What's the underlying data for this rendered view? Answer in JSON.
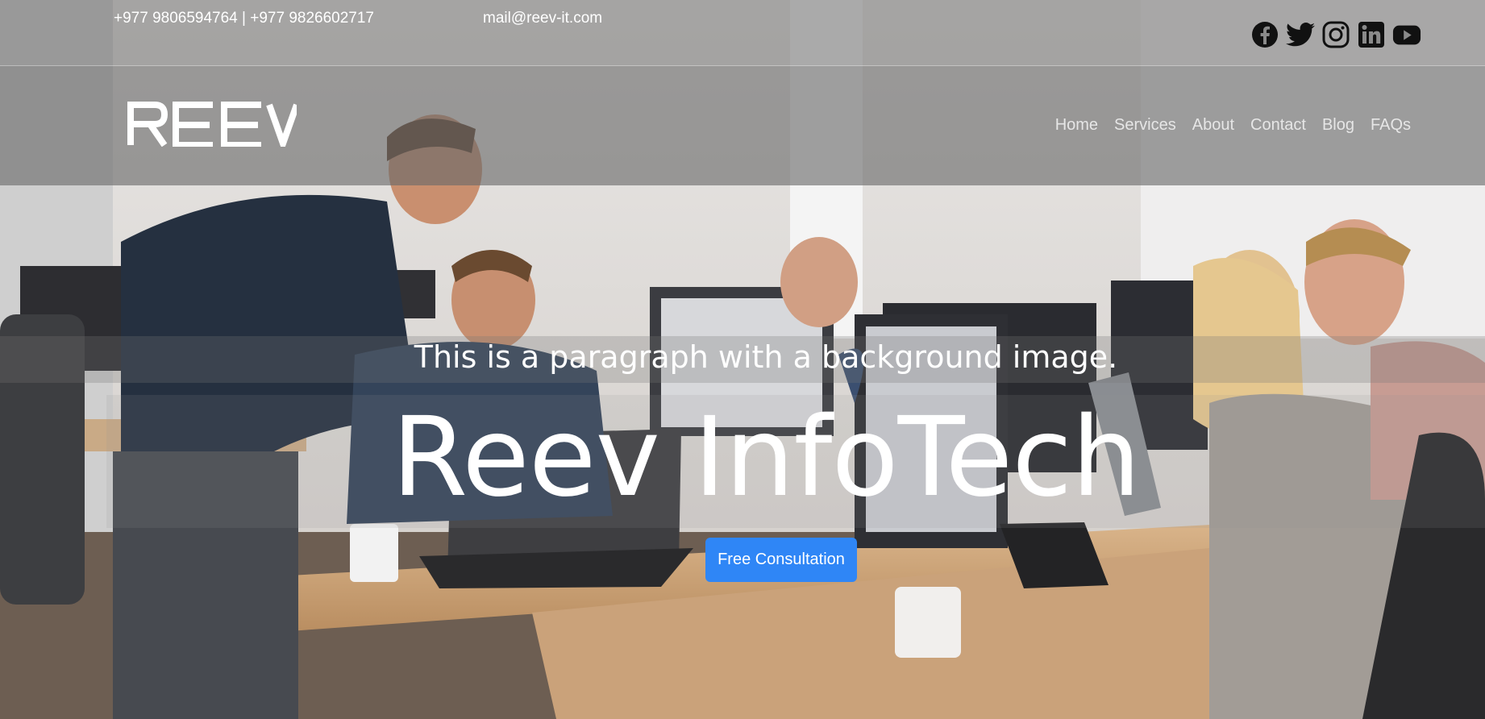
{
  "topbar": {
    "phones": "+977 9806594764 | +977 9826602717",
    "email": "mail@reev-it.com"
  },
  "social": [
    {
      "icon": "facebook-icon"
    },
    {
      "icon": "twitter-icon"
    },
    {
      "icon": "instagram-icon"
    },
    {
      "icon": "linkedin-icon"
    },
    {
      "icon": "youtube-icon"
    }
  ],
  "brand": {
    "logo_text": "REEV"
  },
  "nav": {
    "items": [
      {
        "label": "Home"
      },
      {
        "label": "Services"
      },
      {
        "label": "About"
      },
      {
        "label": "Contact"
      },
      {
        "label": "Blog"
      },
      {
        "label": "FAQs"
      }
    ]
  },
  "hero": {
    "tagline": "This is a paragraph with a background image.",
    "title": "Reev InfoTech",
    "cta_label": "Free Consultation"
  },
  "colors": {
    "accent": "#2f86f6",
    "text": "#ffffff"
  }
}
